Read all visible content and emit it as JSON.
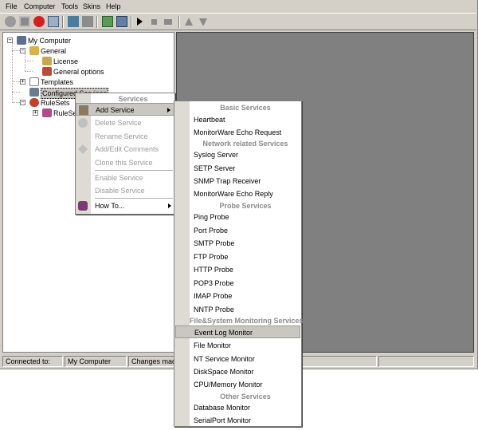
{
  "menubar": {
    "file": "File",
    "computer": "Computer",
    "tools": "Tools",
    "skins": "Skins",
    "help": "Help"
  },
  "toolbar": {
    "icons": [
      "check-icon",
      "save-icon",
      "stop-icon",
      "search-icon",
      "network-icon",
      "grid-icon",
      "refresh-icon",
      "report-icon",
      "play-icon",
      "stop-square-icon",
      "step-icon",
      "up-arrow-icon",
      "down-arrow-icon"
    ]
  },
  "tree": {
    "my_computer": "My Computer",
    "general": "General",
    "license": "License",
    "general_options": "General options",
    "templates": "Templates",
    "configured_services": "Configured Services",
    "rulesets": "RuleSets",
    "ruleset_child": "RuleSet"
  },
  "context_menu": {
    "header": "Services",
    "add_service": "Add Service",
    "delete_service": "Delete Service",
    "rename_service": "Rename Service",
    "add_edit_comments": "Add/Edit Comments",
    "clone_service": "Clone this Service",
    "enable_service": "Enable Service",
    "disable_service": "Disable Service",
    "how_to": "How To..."
  },
  "submenu": {
    "basic_header": "Basic Services",
    "heartbeat": "Heartbeat",
    "echo_request": "MonitorWare Echo Request",
    "network_header": "Network related Services",
    "syslog": "Syslog Server",
    "setp": "SETP Server",
    "snmp": "SNMP Trap Receiver",
    "echo_reply": "MonitorWare Echo Reply",
    "probe_header": "Probe Services",
    "ping": "Ping Probe",
    "port": "Port Probe",
    "smtp": "SMTP Probe",
    "ftp": "FTP Probe",
    "http": "HTTP Probe",
    "pop3": "POP3 Probe",
    "imap": "IMAP Probe",
    "nntp": "NNTP Probe",
    "filesystem_header": "File&System Monitoring Services",
    "eventlog": "Event Log Monitor",
    "file": "File Monitor",
    "ntservice": "NT Service Monitor",
    "diskspace": "DiskSpace Monitor",
    "cpu": "CPU/Memory Monitor",
    "other_header": "Other Services",
    "database": "Database Monitor",
    "serialport": "SerialPort Monitor"
  },
  "status": {
    "connected_label": "Connected to:",
    "computer": "My Computer",
    "changes": "Changes made"
  },
  "colors": {
    "chrome": "#d4d0c8",
    "workspace": "#808080",
    "menu_bg": "#ffffff",
    "menu_strip": "#dedbd5",
    "disabled_text": "#9a9a9a"
  }
}
